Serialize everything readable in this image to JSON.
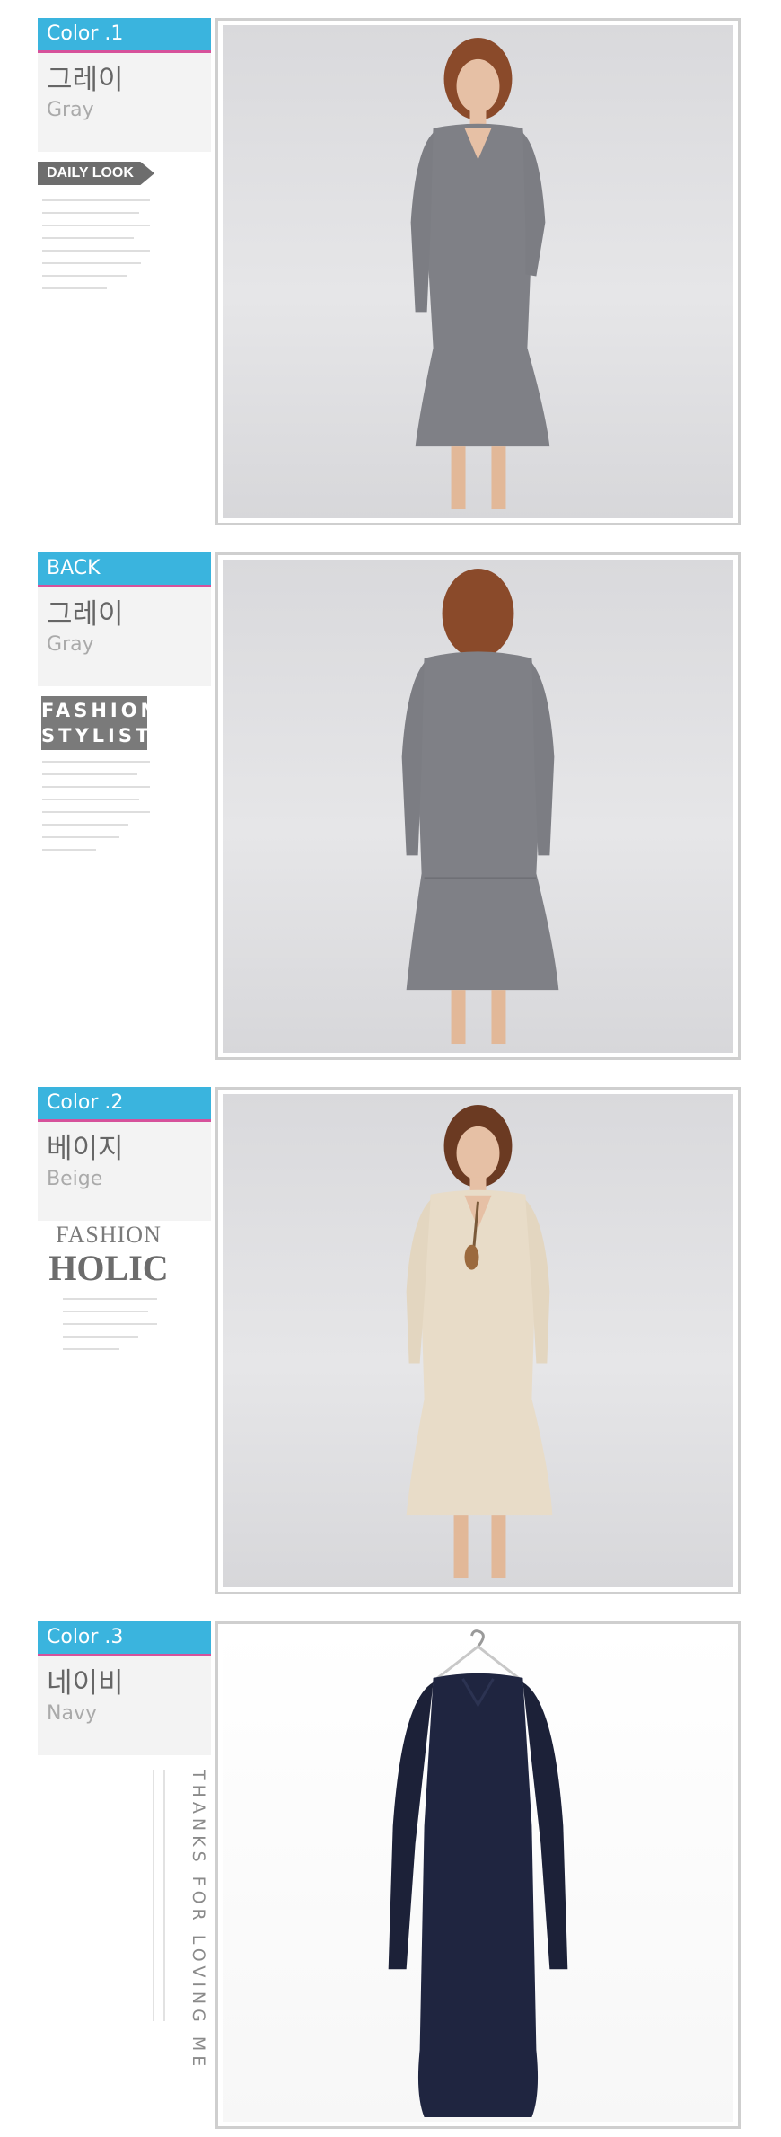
{
  "sections": [
    {
      "tag": "Color .1",
      "korean": "그레이",
      "english": "Gray",
      "badge": "DAILY LOOK",
      "photo": "gray-dress-front"
    },
    {
      "tag": "BACK",
      "korean": "그레이",
      "english": "Gray",
      "badge_lines": [
        "FASHION",
        "STYLIST"
      ],
      "photo": "gray-dress-back"
    },
    {
      "tag": "Color .2",
      "korean": "베이지",
      "english": "Beige",
      "badge_lines": [
        "FASHION",
        "HOLIC"
      ],
      "photo": "beige-dress-front"
    },
    {
      "tag": "Color .3",
      "korean": "네이비",
      "english": "Navy",
      "badge": "THANKS FOR LOVING ME",
      "photo": "navy-dress-hanger"
    }
  ],
  "colors": {
    "tag_blue": "#3ab4de",
    "tag_underline": "#d6519b",
    "gray_dress": "#7f8086",
    "beige_dress": "#e8dcc8",
    "navy_dress": "#1f2540"
  }
}
